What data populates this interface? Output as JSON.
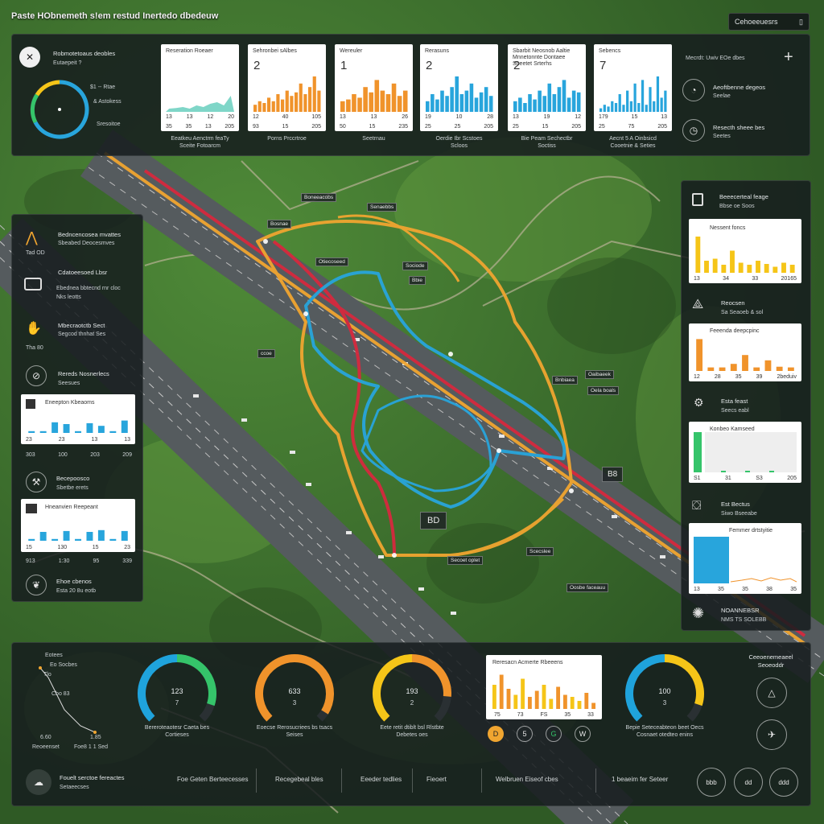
{
  "app": {
    "title": "Paste HObnemeth s!em restud Inertedo dbedeuw",
    "top_button": "Cehoeeuesrs"
  },
  "header": {
    "gauge_label": "Robmotetoaus deobles",
    "gauge_sub": "Eutaepeit ?",
    "gauge_items": [
      "$1 -- Rtae",
      "& Astokess",
      "Sresoitoe"
    ],
    "gauge_value": 0.72,
    "cards": [
      {
        "title": "Reseration Roeaer",
        "number": "",
        "ticks": [
          "13",
          "13",
          "12",
          "20"
        ],
        "ticks2": [
          "35",
          "35",
          "13",
          "205"
        ],
        "caption": "Eeatkeu Aenctrm feaTy",
        "caption2": "Sceite Fotoarcm"
      },
      {
        "title": "Sehronbei sAlbes",
        "number": "2",
        "ticks": [
          "12",
          "40",
          "105"
        ],
        "ticks2": [
          "93",
          "15",
          "205"
        ],
        "caption": "Porns Prccrtroe",
        "caption2": ""
      },
      {
        "title": "Wereuler",
        "number": "1",
        "ticks": [
          "13",
          "13",
          "26"
        ],
        "ticks2": [
          "50",
          "15",
          "235"
        ],
        "caption": "Seetrnau",
        "caption2": ""
      },
      {
        "title": "Rerasuns",
        "number": "2",
        "ticks": [
          "19",
          "10",
          "28"
        ],
        "ticks2": [
          "25",
          "25",
          "205"
        ],
        "caption": "Oerdie Ibr Scstoes",
        "caption2": "Scloos"
      },
      {
        "title": "Sbarbit Neosnob Aaltie Mnnetonnte Dontaee Sueetet Srterhs",
        "number": "2",
        "ticks": [
          "13",
          "19",
          "12"
        ],
        "ticks2": [
          "25",
          "15",
          "205"
        ],
        "caption": "Bie Peam Sechectbr",
        "caption2": "Soctiss"
      },
      {
        "title": "Sebencs",
        "number": "7",
        "ticks": [
          "179",
          "15",
          "13"
        ],
        "ticks2": [
          "25",
          "75",
          "205"
        ],
        "caption": "Aecnt 5 A Oinbsicd",
        "caption2": "Cooetnie & Seties"
      }
    ],
    "right_top": "Mecrdt: Uwiv EOe dbes",
    "right_items": [
      {
        "icon": "speed-icon",
        "label": "Aeoftbenne degeos",
        "sub": "Seelae"
      },
      {
        "icon": "clock-icon",
        "label": "Resecth sheee bes",
        "sub": "Seetes"
      }
    ]
  },
  "left_panel": {
    "items": [
      {
        "label": "Bedncencosea mvattes",
        "sub": "Sbeabed Deocesmves",
        "note": "Tad OD"
      },
      {
        "label": "Cdatoeesoed Lbsr",
        "sub": "Ebednea bbtecnd rnr cloc",
        "note": "Nks leotts"
      },
      {
        "label": "Mbecraotctb Sect",
        "sub": "Segcod thnhat Ses",
        "note": "Tha 80"
      },
      {
        "label": "Rereds Nosnerlecs",
        "sub": "Seesues",
        "note": ""
      }
    ],
    "card1": {
      "title": "Eneepton Kbeaoms",
      "ticks": [
        "23",
        "23",
        "13",
        "13"
      ],
      "foot": [
        "303",
        "100",
        "203",
        "209"
      ]
    },
    "item5": {
      "label": "Becepoosco",
      "sub": "Sbetbe erets"
    },
    "card2": {
      "title": "Hneanvien Reepeant",
      "ticks": [
        "15",
        "130",
        "15",
        "23"
      ],
      "foot": [
        "913",
        "1:30",
        "95",
        "339"
      ]
    },
    "item6": {
      "label": "Ehoe cbenos",
      "sub": "Esta 20 8u eotb"
    }
  },
  "right_panel": {
    "header": {
      "label": "Beeecerteal feage",
      "sub": "Bbse oe Soos"
    },
    "card1": {
      "title": "Nessent foncs",
      "ticks": [
        "13",
        "34",
        "33",
        "20165"
      ],
      "values": [
        0.9,
        0.3,
        0.35,
        0.2,
        0.55,
        0.25,
        0.2,
        0.3,
        0.22,
        0.15,
        0.25,
        0.2
      ]
    },
    "item2": {
      "label": "Reocsen",
      "sub": "Sa Seaoeb & sol"
    },
    "card2": {
      "title": "Feeenda deepcpinc",
      "ticks": [
        "12",
        "28",
        "35",
        "39",
        "2beduiv"
      ],
      "values": [
        0.9,
        0.1,
        0.1,
        0.2,
        0.45,
        0.1,
        0.3,
        0.12,
        0.1
      ]
    },
    "item3": {
      "label": "Esta feast",
      "sub": "Seecs eabl"
    },
    "card3": {
      "title": "Konbeo Kamseed",
      "ticks": [
        "S1",
        "31",
        "S3",
        "205"
      ],
      "values": [
        1.0,
        0.05,
        0.05,
        0.05
      ]
    },
    "item4": {
      "label": "Est Bectus",
      "sub": "Siwo Bseeabe"
    },
    "card4": {
      "title": "Femmer drtstyitie",
      "ticks": [
        "13",
        "35",
        "35",
        "38",
        "35"
      ],
      "values": [
        1.0,
        0.1,
        0.05,
        0.08,
        0.06
      ]
    },
    "item5": {
      "label": "NOANNEBSR",
      "sub": "NMS TS SOLEBB"
    }
  },
  "map_tags": [
    "Boneeacobs",
    "Senaebbs",
    "Bosnae",
    "Otiecoseed",
    "Sociode",
    "Bbie",
    "ccoe",
    "Bnbiaea",
    "Oaibaeek",
    "Oela boals",
    "Scecslee",
    "Secoet oplet",
    "Oosbe faceauu",
    "B8",
    "BD"
  ],
  "bottom": {
    "mini": {
      "labels": [
        "Eotees",
        "Eo Socbes",
        "Tlo",
        "Cbo 83",
        "6.60",
        "1.85",
        "Reoeenset",
        "Foe8 1 1 Sed"
      ]
    },
    "gauges": [
      {
        "value": "123",
        "sub": "7",
        "caption": "Bereroteaotesr Caeta bes",
        "caption2": "Cortieses",
        "color_a": "#1fa3dc",
        "color_b": "#35c46a",
        "fill": 0.9
      },
      {
        "value": "633",
        "sub": "3",
        "caption": "Eoecse Rerosucriees bs tsacs",
        "caption2": "Seises",
        "color_a": "#f0932b",
        "color_b": "#f0932b",
        "fill": 0.95
      },
      {
        "value": "193",
        "sub": "2",
        "caption": "Eete retit dtiblt bsl Rlstbte",
        "caption2": "Debetes oes",
        "color_a": "#f5c518",
        "color_b": "#f0932b",
        "fill": 0.85
      },
      {
        "value": "100",
        "sub": "3",
        "caption": "Bepie Seteceabteon beet Oecs",
        "caption2": "Cosnaet otedteo enins",
        "color_a": "#1fa3dc",
        "color_b": "#f5c518",
        "fill": 0.9
      }
    ],
    "card": {
      "title": "Reresacn Acmerte Rbeeens",
      "ticks": [
        "75",
        "73",
        "FS",
        "35",
        "33"
      ],
      "values": [
        0.6,
        0.85,
        0.5,
        0.35,
        0.75,
        0.3,
        0.45,
        0.6,
        0.25,
        0.55,
        0.35,
        0.3,
        0.2,
        0.4,
        0.15
      ]
    },
    "chips": [
      "D",
      "5",
      "G",
      "W"
    ],
    "right_title": "Ceeoenemeaeel Seoeoddr",
    "footer": {
      "left_label": "Fouelt serctoe fereactes",
      "left_sub": "Setaeecses",
      "items": [
        "Foe Geten Berteecesses",
        "Recegebeal bles",
        "Eeeder tedlies",
        "Fieoert",
        "Welbruen Eiseof cbes",
        "1 beaeim fer Seteer"
      ],
      "buttons": [
        "bbb",
        "dd",
        "ddd"
      ]
    }
  }
}
